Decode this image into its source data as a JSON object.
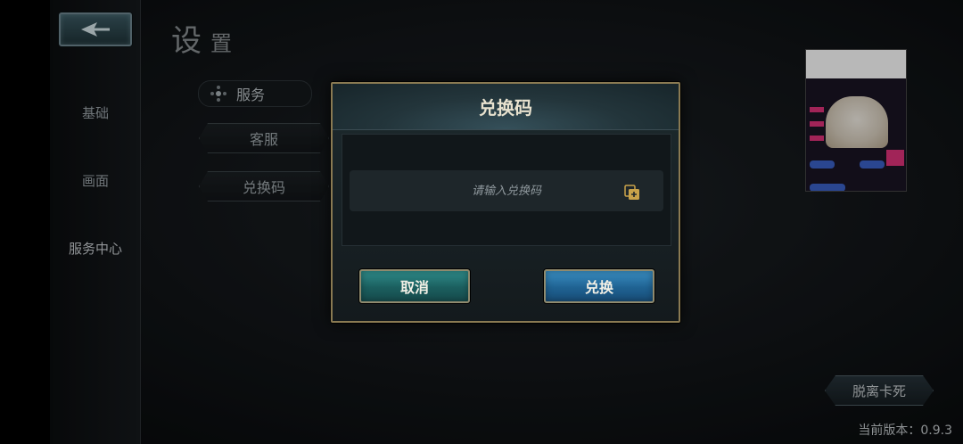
{
  "page": {
    "title_main": "设",
    "title_sub": "置",
    "version_text": "当前版本：0.9.3",
    "escape_label": "脱离卡死"
  },
  "sidebar": {
    "items": [
      {
        "label": "基础"
      },
      {
        "label": "画面"
      },
      {
        "label": "服务中心"
      }
    ]
  },
  "service_menu": {
    "header": "服务",
    "tabs": [
      {
        "label": "客服"
      },
      {
        "label": "兑换码"
      }
    ]
  },
  "dialog": {
    "title": "兑换码",
    "input_value": "",
    "input_placeholder": "请输入兑换码",
    "cancel_label": "取消",
    "confirm_label": "兑换"
  },
  "colors": {
    "dialog_border": "#8a7a52",
    "cancel_button": "#1b5e5e",
    "confirm_button": "#1f6292"
  },
  "icons": {
    "back": "back-arrow-icon",
    "menu_header": "diamond-cross-icon",
    "paste": "paste-icon"
  }
}
